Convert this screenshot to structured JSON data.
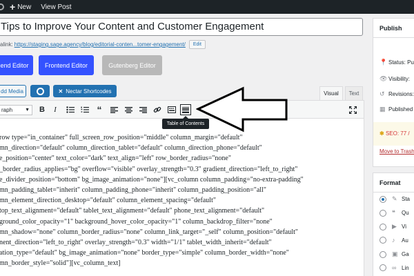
{
  "admin_bar": {
    "new_label": "New",
    "view_post_label": "View Post"
  },
  "post": {
    "title": "Tips to Improve Your Content and Customer Engagement",
    "permalink_label": "alink:",
    "permalink_url": "https://staging.sage.agency/blog/editorial-conten...tomer-engagement/",
    "edit_label": "Edit"
  },
  "editor_buttons": {
    "backend": "end Editor",
    "frontend": "Frontend Editor",
    "gutenberg": "Gutenberg Editor"
  },
  "media": {
    "add_media": "dd Media",
    "nectar": "Nectar Shortcodes"
  },
  "tabs": {
    "visual": "Visual",
    "text": "Text"
  },
  "toolbar": {
    "format_value": "raph",
    "bold": "B",
    "italic": "I",
    "quote": "“",
    "tooltip": "Table of Contents"
  },
  "content_lines": [
    "row type=\"in_container\" full_screen_row_position=\"middle\" column_margin=\"default\"",
    "mn_direction=\"default\" column_direction_tablet=\"default\" column_direction_phone=\"default\"",
    "e_position=\"center\" text_color=\"dark\" text_align=\"left\" row_border_radius=\"none\"",
    "_border_radius_applies=\"bg\" overflow=\"visible\" overlay_strength=\"0.3\" gradient_direction=\"left_to_right\"",
    "e_divider_position=\"bottom\" bg_image_animation=\"none\"][vc_column column_padding=\"no-extra-padding\"",
    "mn_padding_tablet=\"inherit\" column_padding_phone=\"inherit\" column_padding_position=\"all\"",
    "mn_element_direction_desktop=\"default\" column_element_spacing=\"default\"",
    "top_text_alignment=\"default\" tablet_text_alignment=\"default\" phone_text_alignment=\"default\"",
    "ground_color_opacity=\"1\" background_hover_color_opacity=\"1\" column_backdrop_filter=\"none\"",
    "mn_shadow=\"none\" column_border_radius=\"none\" column_link_target=\"_self\" column_position=\"default\"",
    "nent_direction=\"left_to_right\" overlay_strength=\"0.3\" width=\"1/1\" tablet_width_inherit=\"default\"",
    "ation_type=\"default\" bg_image_animation=\"none\" border_type=\"simple\" column_border_width=\"none\"",
    "mn_border_style=\"solid\"][vc_column_text]"
  ],
  "publish": {
    "heading": "Publish",
    "status": "Status: Pu",
    "visibility": "Visibility:",
    "revisions": "Revisions:",
    "published": "Published",
    "seo": "SEO: 77 /",
    "trash": "Move to Trash"
  },
  "format": {
    "heading": "Format",
    "options": [
      "Sta",
      "Qu",
      "Vi",
      "Au",
      "Ga",
      "Lin"
    ]
  },
  "colors": {
    "accent_blue": "#3452ff",
    "wp_blue": "#2271b1",
    "admin_bar": "#1d2327"
  }
}
